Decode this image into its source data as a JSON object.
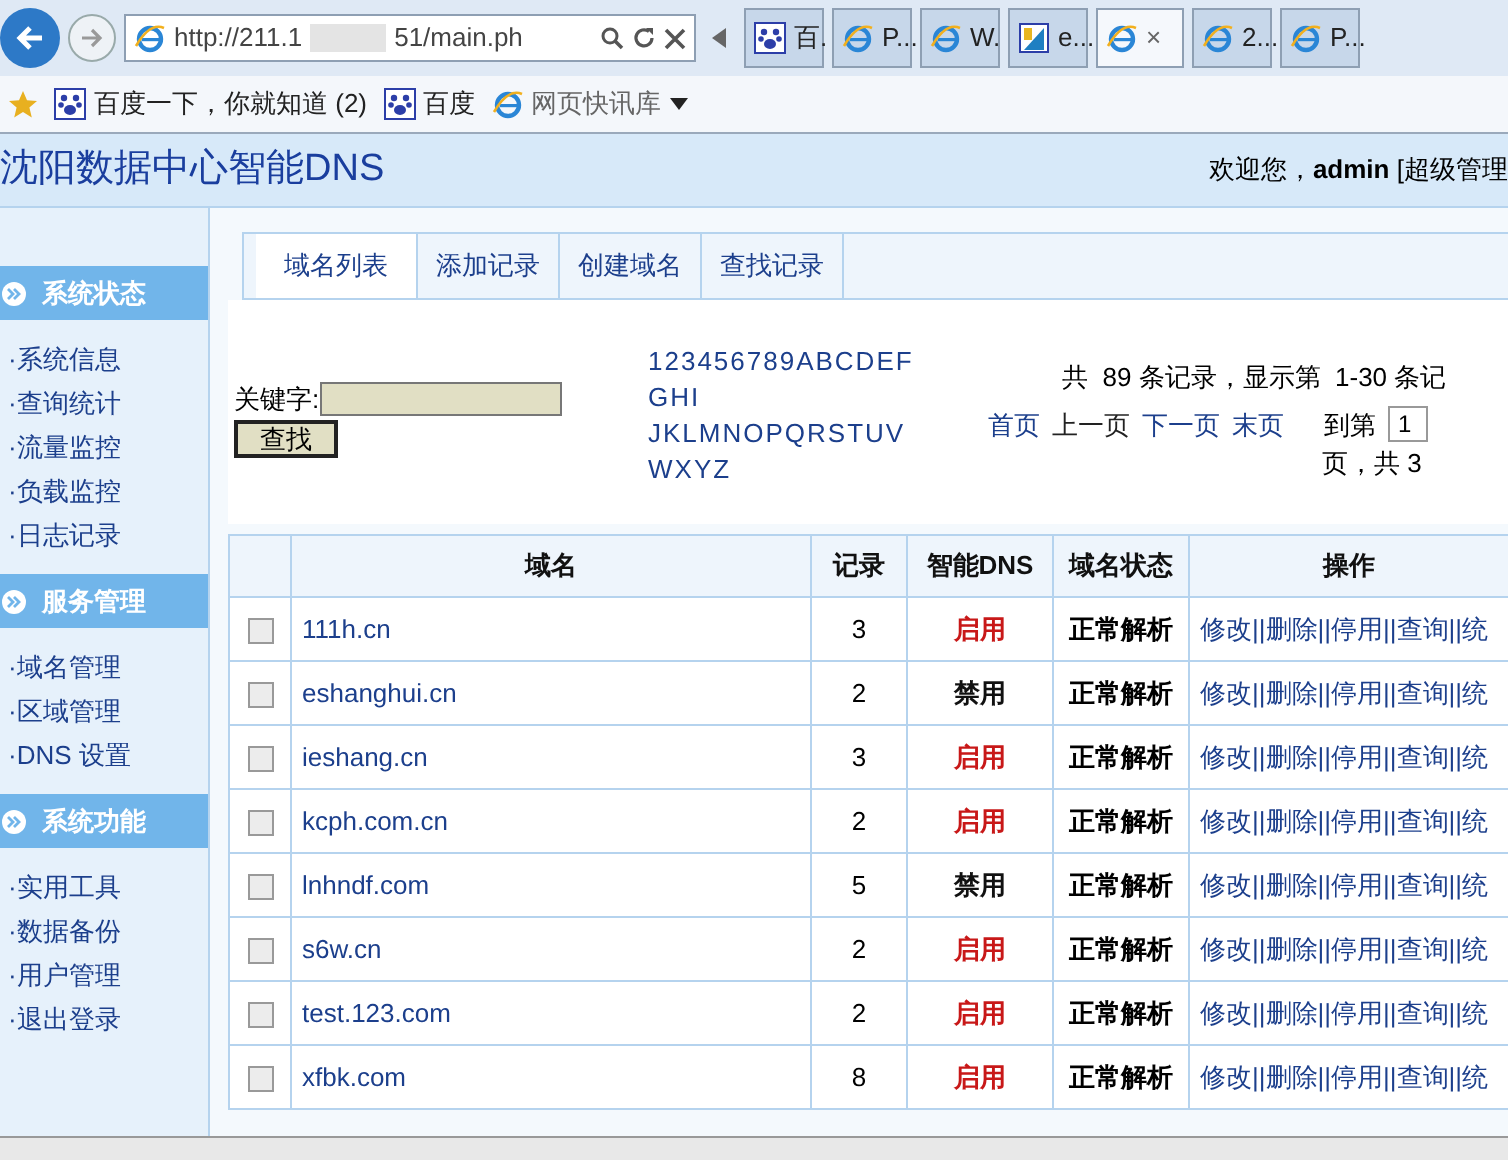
{
  "browser": {
    "address_start": "http://211.1",
    "address_end": "51/main.ph",
    "tabs": [
      {
        "title": "百.",
        "kind": "paw",
        "selected": false
      },
      {
        "title": "P...",
        "kind": "ie",
        "selected": false
      },
      {
        "title": "W.",
        "kind": "ie",
        "selected": false
      },
      {
        "title": "e...",
        "kind": "doc",
        "selected": false
      },
      {
        "title": "×",
        "kind": "ie",
        "selected": true
      },
      {
        "title": "2...",
        "kind": "ie",
        "selected": false
      },
      {
        "title": "P...",
        "kind": "ie",
        "selected": false
      }
    ],
    "favorites": [
      {
        "label": "百度一下，你就知道 (2)",
        "kind": "paw"
      },
      {
        "label": "百度",
        "kind": "paw"
      },
      {
        "label": "网页快讯库",
        "kind": "ie"
      }
    ]
  },
  "header": {
    "title": "沈阳数据中心智能DNS",
    "welcome": "欢迎您，",
    "user": "admin",
    "role": "[超级管理"
  },
  "sidebar": [
    {
      "title": "系统状态",
      "items": [
        "·系统信息",
        "·查询统计",
        "·流量监控",
        "·负载监控",
        "·日志记录"
      ]
    },
    {
      "title": "服务管理",
      "items": [
        "·域名管理",
        "·区域管理",
        "·DNS 设置"
      ]
    },
    {
      "title": "系统功能",
      "items": [
        "·实用工具",
        "·数据备份",
        "·用户管理",
        "·退出登录"
      ]
    }
  ],
  "tabs": [
    {
      "label": "域名列表",
      "selected": true
    },
    {
      "label": "添加记录",
      "selected": false
    },
    {
      "label": "创建域名",
      "selected": false
    },
    {
      "label": "查找记录",
      "selected": false
    }
  ],
  "search": {
    "label": "关键字:",
    "button": "查找"
  },
  "index_lines": [
    "123456789ABCDEF",
    "GHI",
    "JKLMNOPQRSTUV",
    "WXYZ"
  ],
  "pager": {
    "summary": "共  89 条记录，显示第  1-30 条记",
    "links": [
      "首页",
      "上一页",
      "下一页",
      "末页"
    ],
    "goto": "到第",
    "page": "1",
    "total": "页，共 3"
  },
  "table": {
    "columns": [
      "域名",
      "记录",
      "智能DNS",
      "域名状态",
      "操作"
    ],
    "rows": [
      {
        "domain": "111h.cn",
        "records": "3",
        "dns": "启用",
        "dns_on": true,
        "status": "正常解析",
        "actions": "修改||删除||停用||查询||统",
        "checked": false
      },
      {
        "domain": "eshanghui.cn",
        "records": "2",
        "dns": "禁用",
        "dns_on": false,
        "status": "正常解析",
        "actions": "修改||删除||停用||查询||统",
        "checked": false
      },
      {
        "domain": "ieshang.cn",
        "records": "3",
        "dns": "启用",
        "dns_on": true,
        "status": "正常解析",
        "actions": "修改||删除||停用||查询||统",
        "checked": false
      },
      {
        "domain": "kcph.com.cn",
        "records": "2",
        "dns": "启用",
        "dns_on": true,
        "status": "正常解析",
        "actions": "修改||删除||停用||查询||统",
        "checked": false
      },
      {
        "domain": "lnhndf.com",
        "records": "5",
        "dns": "禁用",
        "dns_on": false,
        "status": "正常解析",
        "actions": "修改||删除||停用||查询||统",
        "checked": false
      },
      {
        "domain": "s6w.cn",
        "records": "2",
        "dns": "启用",
        "dns_on": true,
        "status": "正常解析",
        "actions": "修改||删除||停用||查询||统",
        "checked": false
      },
      {
        "domain": "test.123.com",
        "records": "2",
        "dns": "启用",
        "dns_on": true,
        "status": "正常解析",
        "actions": "修改||删除||停用||查询||统",
        "checked": false
      },
      {
        "domain": "xfbk.com",
        "records": "8",
        "dns": "启用",
        "dns_on": true,
        "status": "正常解析",
        "actions": "修改||删除||停用||查询||统",
        "checked": false
      }
    ]
  }
}
